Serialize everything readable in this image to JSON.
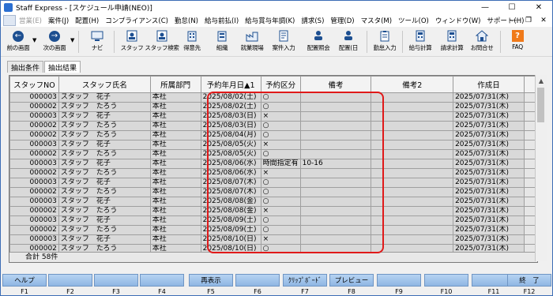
{
  "window": {
    "title": "Staff Express - [スケジュール申請(NEO)]",
    "minimize": "—",
    "maximize": "☐",
    "close": "✕"
  },
  "menu": [
    {
      "label": "営業(E)",
      "disabled": true
    },
    {
      "label": "案件(J)",
      "disabled": false
    },
    {
      "label": "配置(H)",
      "disabled": false
    },
    {
      "label": "コンプライアンス(C)",
      "disabled": false
    },
    {
      "label": "勤怠(N)",
      "disabled": false
    },
    {
      "label": "給与前払(I)",
      "disabled": false
    },
    {
      "label": "給与賞与年調(K)",
      "disabled": false
    },
    {
      "label": "請求(S)",
      "disabled": false
    },
    {
      "label": "管理(D)",
      "disabled": false
    },
    {
      "label": "マスタ(M)",
      "disabled": false
    },
    {
      "label": "ツール(O)",
      "disabled": false
    },
    {
      "label": "ウィンドウ(W)",
      "disabled": false
    },
    {
      "label": "サポート(H)",
      "disabled": false
    }
  ],
  "toolbar": {
    "prev": "前の画面",
    "next": "次の画面",
    "navi": "ナビ",
    "staff": "スタッフ",
    "staff_search": "スタッフ検索",
    "client": "得意先",
    "org": "組織",
    "site": "就業現場",
    "job_entry": "案件入力",
    "assign_check": "配置照会",
    "assign_day": "配置(日",
    "attendance": "勤怠入力",
    "payroll": "給与計算",
    "billing": "請求計算",
    "contact": "お問合せ",
    "faq": "FAQ",
    "faq_badge": "?"
  },
  "tabs": [
    "抽出条件",
    "抽出結果"
  ],
  "grid": {
    "columns": [
      "スタッフNO",
      "スタッフ氏名",
      "所属部門",
      "予約年月日▲1",
      "予約区分",
      "備考",
      "備考2",
      "作成日"
    ],
    "rows": [
      [
        "000003",
        "スタッフ　花子",
        "本社",
        "2025/08/02(土)",
        "○",
        "",
        "",
        "2025/07/31(木)"
      ],
      [
        "000002",
        "スタッフ　たろう",
        "本社",
        "2025/08/02(土)",
        "○",
        "",
        "",
        "2025/07/31(木)"
      ],
      [
        "000003",
        "スタッフ　花子",
        "本社",
        "2025/08/03(日)",
        "×",
        "",
        "",
        "2025/07/31(木)"
      ],
      [
        "000002",
        "スタッフ　たろう",
        "本社",
        "2025/08/03(日)",
        "○",
        "",
        "",
        "2025/07/31(木)"
      ],
      [
        "000002",
        "スタッフ　たろう",
        "本社",
        "2025/08/04(月)",
        "○",
        "",
        "",
        "2025/07/31(木)"
      ],
      [
        "000003",
        "スタッフ　花子",
        "本社",
        "2025/08/05(火)",
        "×",
        "",
        "",
        "2025/07/31(木)"
      ],
      [
        "000002",
        "スタッフ　たろう",
        "本社",
        "2025/08/05(火)",
        "○",
        "",
        "",
        "2025/07/31(木)"
      ],
      [
        "000003",
        "スタッフ　花子",
        "本社",
        "2025/08/06(水)",
        "時間指定有",
        "10-16",
        "",
        "2025/07/31(木)"
      ],
      [
        "000002",
        "スタッフ　たろう",
        "本社",
        "2025/08/06(水)",
        "×",
        "",
        "",
        "2025/07/31(木)"
      ],
      [
        "000003",
        "スタッフ　花子",
        "本社",
        "2025/08/07(木)",
        "○",
        "",
        "",
        "2025/07/31(木)"
      ],
      [
        "000002",
        "スタッフ　たろう",
        "本社",
        "2025/08/07(木)",
        "○",
        "",
        "",
        "2025/07/31(木)"
      ],
      [
        "000003",
        "スタッフ　花子",
        "本社",
        "2025/08/08(金)",
        "○",
        "",
        "",
        "2025/07/31(木)"
      ],
      [
        "000002",
        "スタッフ　たろう",
        "本社",
        "2025/08/08(金)",
        "×",
        "",
        "",
        "2025/07/31(木)"
      ],
      [
        "000003",
        "スタッフ　花子",
        "本社",
        "2025/08/09(土)",
        "○",
        "",
        "",
        "2025/07/31(木)"
      ],
      [
        "000002",
        "スタッフ　たろう",
        "本社",
        "2025/08/09(土)",
        "○",
        "",
        "",
        "2025/07/31(木)"
      ],
      [
        "000003",
        "スタッフ　花子",
        "本社",
        "2025/08/10(日)",
        "×",
        "",
        "",
        "2025/07/31(木)"
      ],
      [
        "000002",
        "スタッフ　たろう",
        "本社",
        "2025/08/10(日)",
        "○",
        "",
        "",
        "2025/07/31(木)"
      ]
    ],
    "total": "合計 58件"
  },
  "fkeys": [
    {
      "label": "ヘルプ",
      "key": "F1"
    },
    {
      "label": "",
      "key": "F2"
    },
    {
      "label": "",
      "key": "F3"
    },
    {
      "label": "",
      "key": "F4"
    },
    {
      "label": "再表示",
      "key": "F5"
    },
    {
      "label": "ｸﾘｯﾌﾟﾎﾞｰﾄﾞ",
      "key": "F7"
    },
    {
      "label": "プレビュー",
      "key": "F8"
    },
    {
      "label": "",
      "key": "F9"
    },
    {
      "label": "",
      "key": "F10"
    },
    {
      "label": "",
      "key": "F11"
    },
    {
      "label": "終　了",
      "key": "F12"
    }
  ],
  "colors": {
    "accent": "#1d4f91",
    "highlight": "#e01a1a",
    "fkey": "#a7c7ec",
    "faq": "#f07a1a"
  }
}
